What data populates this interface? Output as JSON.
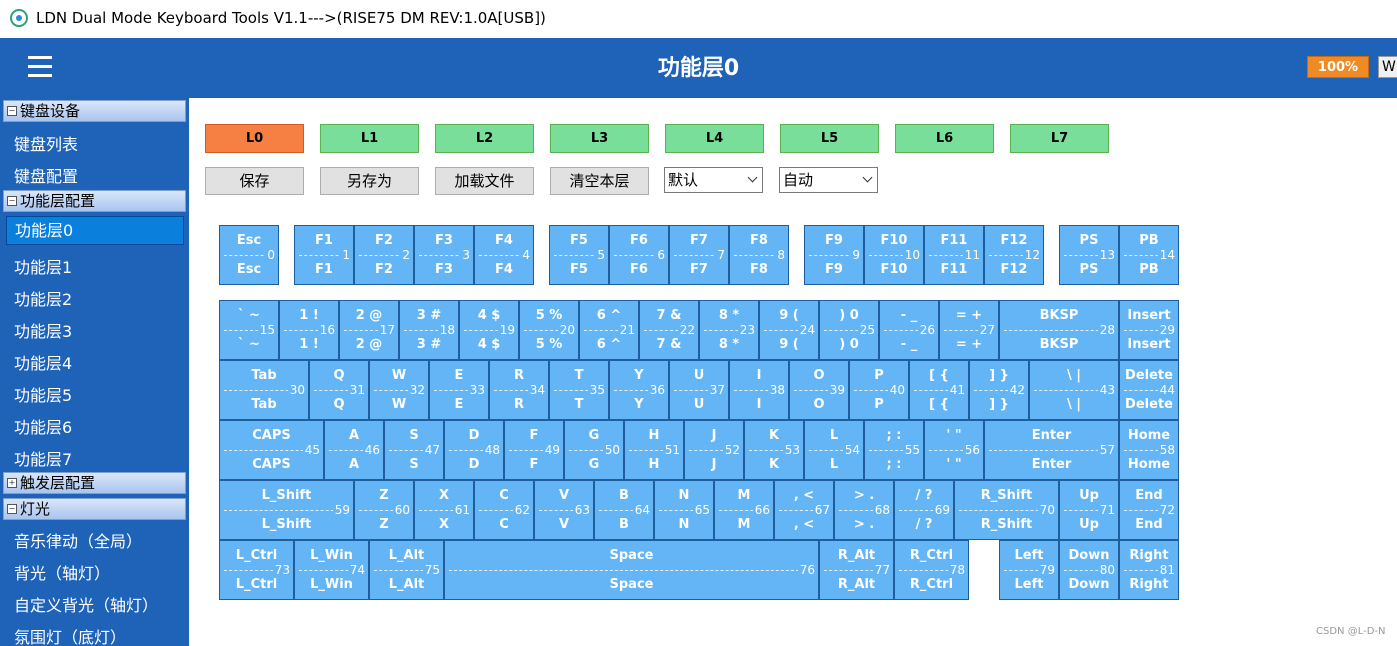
{
  "window": {
    "title": "LDN Dual Mode Keyboard Tools V1.1--->(RISE75 DM REV:1.0A[USB])"
  },
  "header": {
    "title": "功能层0",
    "zoom": "100%",
    "w_button": "W"
  },
  "sidebar": {
    "groups": [
      {
        "label": "键盘设备",
        "expander": "−"
      },
      {
        "label": "功能层配置",
        "expander": "−"
      },
      {
        "label": "触发层配置",
        "expander": "+"
      },
      {
        "label": "灯光",
        "expander": "−"
      }
    ],
    "items": [
      "键盘列表",
      "键盘配置",
      "功能层0",
      "功能层1",
      "功能层2",
      "功能层3",
      "功能层4",
      "功能层5",
      "功能层6",
      "功能层7",
      "音乐律动（全局）",
      "背光（轴灯）",
      "自定义背光（轴灯）",
      "氛围灯（底灯）"
    ],
    "selected_item": "功能层0"
  },
  "toolbar": {
    "layers": [
      "L0",
      "L1",
      "L2",
      "L3",
      "L4",
      "L5",
      "L6",
      "L7"
    ],
    "active_layer": "L0",
    "actions": [
      "保存",
      "另存为",
      "加载文件",
      "清空本层"
    ],
    "select_default": "默认",
    "select_auto": "自动"
  },
  "colors": {
    "header": "#1e63b8",
    "key": "#64b5f6",
    "layer_button": "#79de9a",
    "active_layer": "#f67f44",
    "zoom_badge": "#f08a24"
  },
  "keys": [
    {
      "t": "Esc",
      "b": "Esc",
      "n": "0"
    },
    {
      "t": "F1",
      "b": "F1",
      "n": "1"
    },
    {
      "t": "F2",
      "b": "F2",
      "n": "2"
    },
    {
      "t": "F3",
      "b": "F3",
      "n": "3"
    },
    {
      "t": "F4",
      "b": "F4",
      "n": "4"
    },
    {
      "t": "F5",
      "b": "F5",
      "n": "5"
    },
    {
      "t": "F6",
      "b": "F6",
      "n": "6"
    },
    {
      "t": "F7",
      "b": "F7",
      "n": "7"
    },
    {
      "t": "F8",
      "b": "F8",
      "n": "8"
    },
    {
      "t": "F9",
      "b": "F9",
      "n": "9"
    },
    {
      "t": "F10",
      "b": "F10",
      "n": "10"
    },
    {
      "t": "F11",
      "b": "F11",
      "n": "11"
    },
    {
      "t": "F12",
      "b": "F12",
      "n": "12"
    },
    {
      "t": "PS",
      "b": "PS",
      "n": "13"
    },
    {
      "t": "PB",
      "b": "PB",
      "n": "14"
    },
    {
      "t": "` ~",
      "b": "` ~",
      "n": "15"
    },
    {
      "t": "1 !",
      "b": "1 !",
      "n": "16"
    },
    {
      "t": "2 @",
      "b": "2 @",
      "n": "17"
    },
    {
      "t": "3 #",
      "b": "3 #",
      "n": "18"
    },
    {
      "t": "4 $",
      "b": "4 $",
      "n": "19"
    },
    {
      "t": "5 %",
      "b": "5 %",
      "n": "20"
    },
    {
      "t": "6 ^",
      "b": "6 ^",
      "n": "21"
    },
    {
      "t": "7 &",
      "b": "7 &",
      "n": "22"
    },
    {
      "t": "8 *",
      "b": "8 *",
      "n": "23"
    },
    {
      "t": "9 (",
      "b": "9 (",
      "n": "24"
    },
    {
      "t": ") 0",
      "b": ") 0",
      "n": "25"
    },
    {
      "t": "- _",
      "b": "- _",
      "n": "26"
    },
    {
      "t": "= +",
      "b": "= +",
      "n": "27"
    },
    {
      "t": "BKSP",
      "b": "BKSP",
      "n": "28"
    },
    {
      "t": "Insert",
      "b": "Insert",
      "n": "29"
    },
    {
      "t": "Tab",
      "b": "Tab",
      "n": "30"
    },
    {
      "t": "Q",
      "b": "Q",
      "n": "31"
    },
    {
      "t": "W",
      "b": "W",
      "n": "32"
    },
    {
      "t": "E",
      "b": "E",
      "n": "33"
    },
    {
      "t": "R",
      "b": "R",
      "n": "34"
    },
    {
      "t": "T",
      "b": "T",
      "n": "35"
    },
    {
      "t": "Y",
      "b": "Y",
      "n": "36"
    },
    {
      "t": "U",
      "b": "U",
      "n": "37"
    },
    {
      "t": "I",
      "b": "I",
      "n": "38"
    },
    {
      "t": "O",
      "b": "O",
      "n": "39"
    },
    {
      "t": "P",
      "b": "P",
      "n": "40"
    },
    {
      "t": "[ {",
      "b": "[ {",
      "n": "41"
    },
    {
      "t": "] }",
      "b": "] }",
      "n": "42"
    },
    {
      "t": "\\ |",
      "b": "\\ |",
      "n": "43"
    },
    {
      "t": "Delete",
      "b": "Delete",
      "n": "44"
    },
    {
      "t": "CAPS",
      "b": "CAPS",
      "n": "45"
    },
    {
      "t": "A",
      "b": "A",
      "n": "46"
    },
    {
      "t": "S",
      "b": "S",
      "n": "47"
    },
    {
      "t": "D",
      "b": "D",
      "n": "48"
    },
    {
      "t": "F",
      "b": "F",
      "n": "49"
    },
    {
      "t": "G",
      "b": "G",
      "n": "50"
    },
    {
      "t": "H",
      "b": "H",
      "n": "51"
    },
    {
      "t": "J",
      "b": "J",
      "n": "52"
    },
    {
      "t": "K",
      "b": "K",
      "n": "53"
    },
    {
      "t": "L",
      "b": "L",
      "n": "54"
    },
    {
      "t": "; :",
      "b": "; :",
      "n": "55"
    },
    {
      "t": "' \"",
      "b": "' \"",
      "n": "56"
    },
    {
      "t": "Enter",
      "b": "Enter",
      "n": "57"
    },
    {
      "t": "Home",
      "b": "Home",
      "n": "58"
    },
    {
      "t": "L_Shift",
      "b": "L_Shift",
      "n": "59"
    },
    {
      "t": "Z",
      "b": "Z",
      "n": "60"
    },
    {
      "t": "X",
      "b": "X",
      "n": "61"
    },
    {
      "t": "C",
      "b": "C",
      "n": "62"
    },
    {
      "t": "V",
      "b": "V",
      "n": "63"
    },
    {
      "t": "B",
      "b": "B",
      "n": "64"
    },
    {
      "t": "N",
      "b": "N",
      "n": "65"
    },
    {
      "t": "M",
      "b": "M",
      "n": "66"
    },
    {
      "t": ", <",
      "b": ", <",
      "n": "67"
    },
    {
      "t": "> .",
      "b": "> .",
      "n": "68"
    },
    {
      "t": "/ ?",
      "b": "/ ?",
      "n": "69"
    },
    {
      "t": "R_Shift",
      "b": "R_Shift",
      "n": "70"
    },
    {
      "t": "Up",
      "b": "Up",
      "n": "71"
    },
    {
      "t": "End",
      "b": "End",
      "n": "72"
    },
    {
      "t": "L_Ctrl",
      "b": "L_Ctrl",
      "n": "73"
    },
    {
      "t": "L_Win",
      "b": "L_Win",
      "n": "74"
    },
    {
      "t": "L_Alt",
      "b": "L_Alt",
      "n": "75"
    },
    {
      "t": "Space",
      "b": "Space",
      "n": "76"
    },
    {
      "t": "R_Alt",
      "b": "R_Alt",
      "n": "77"
    },
    {
      "t": "R_Ctrl",
      "b": "R_Ctrl",
      "n": "78"
    },
    {
      "t": "Left",
      "b": "Left",
      "n": "79"
    },
    {
      "t": "Down",
      "b": "Down",
      "n": "80"
    },
    {
      "t": "Right",
      "b": "Right",
      "n": "81"
    }
  ],
  "watermark": "CSDN @L-D-N"
}
